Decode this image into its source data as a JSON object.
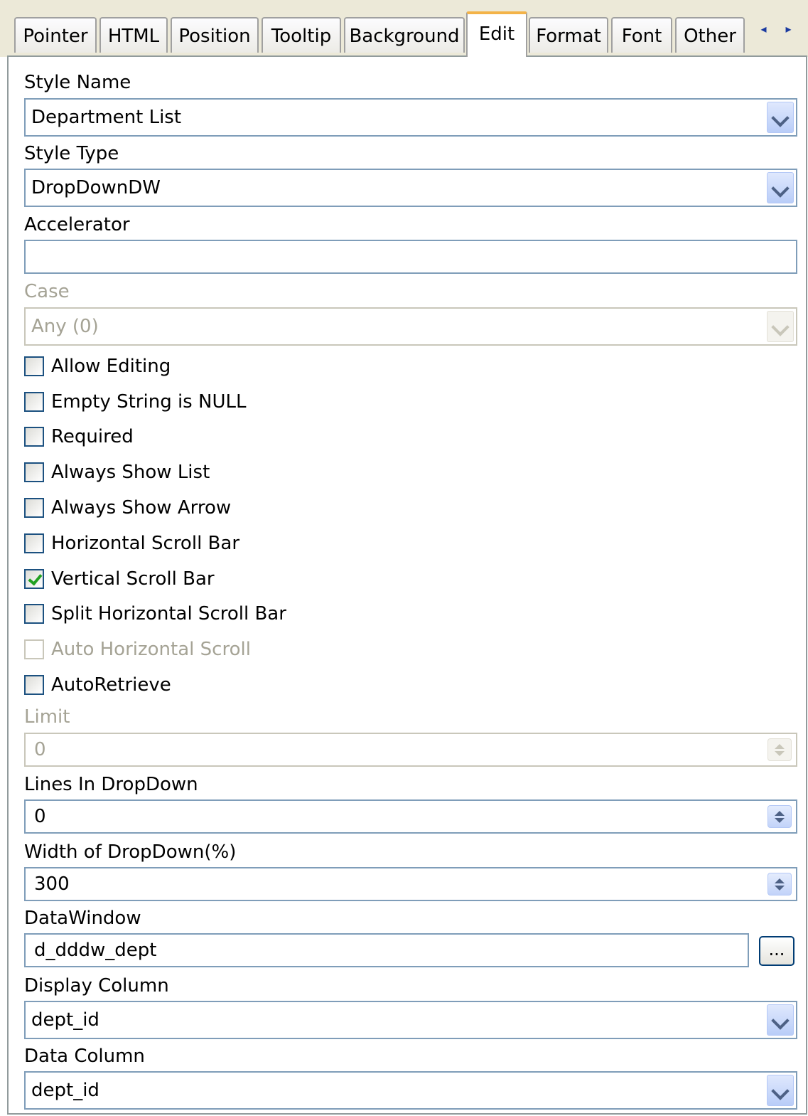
{
  "tabs": [
    {
      "label": "Pointer"
    },
    {
      "label": "HTML"
    },
    {
      "label": "Position"
    },
    {
      "label": "Tooltip"
    },
    {
      "label": "Background"
    },
    {
      "label": "Edit"
    },
    {
      "label": "Format"
    },
    {
      "label": "Font"
    },
    {
      "label": "Other"
    }
  ],
  "active_tab": "Edit",
  "tab_scroll": {
    "left": "◂",
    "right": "▸"
  },
  "fields": {
    "style_name": {
      "label": "Style Name",
      "value": "Department List"
    },
    "style_type": {
      "label": "Style Type",
      "value": "DropDownDW"
    },
    "accelerator": {
      "label": "Accelerator",
      "value": ""
    },
    "case": {
      "label": "Case",
      "value": "Any (0)",
      "disabled": true
    },
    "limit": {
      "label": "Limit",
      "value": "0",
      "disabled": true
    },
    "lines_in_dropdown": {
      "label": "Lines In DropDown",
      "value": "0"
    },
    "width_of_dropdown": {
      "label": "Width of DropDown(%)",
      "value": "300"
    },
    "datawindow": {
      "label": "DataWindow",
      "value": "d_dddw_dept",
      "button": "..."
    },
    "display_column": {
      "label": "Display Column",
      "value": "dept_id"
    },
    "data_column": {
      "label": "Data Column",
      "value": "dept_id"
    }
  },
  "checkboxes": [
    {
      "label": "Allow Editing",
      "checked": false,
      "disabled": false
    },
    {
      "label": "Empty String is NULL",
      "checked": false,
      "disabled": false
    },
    {
      "label": "Required",
      "checked": false,
      "disabled": false
    },
    {
      "label": "Always Show List",
      "checked": false,
      "disabled": false
    },
    {
      "label": "Always Show Arrow",
      "checked": false,
      "disabled": false
    },
    {
      "label": "Horizontal Scroll Bar",
      "checked": false,
      "disabled": false
    },
    {
      "label": "Vertical Scroll Bar",
      "checked": true,
      "disabled": false
    },
    {
      "label": "Split Horizontal Scroll Bar",
      "checked": false,
      "disabled": false
    },
    {
      "label": "Auto Horizontal Scroll",
      "checked": false,
      "disabled": true
    },
    {
      "label": "AutoRetrieve",
      "checked": false,
      "disabled": false
    }
  ],
  "colors": {
    "field_border": "#7f9db9",
    "active_tab_accent": "#f3b348",
    "check_mark": "#21a121",
    "disabled_text": "#a5a395"
  }
}
